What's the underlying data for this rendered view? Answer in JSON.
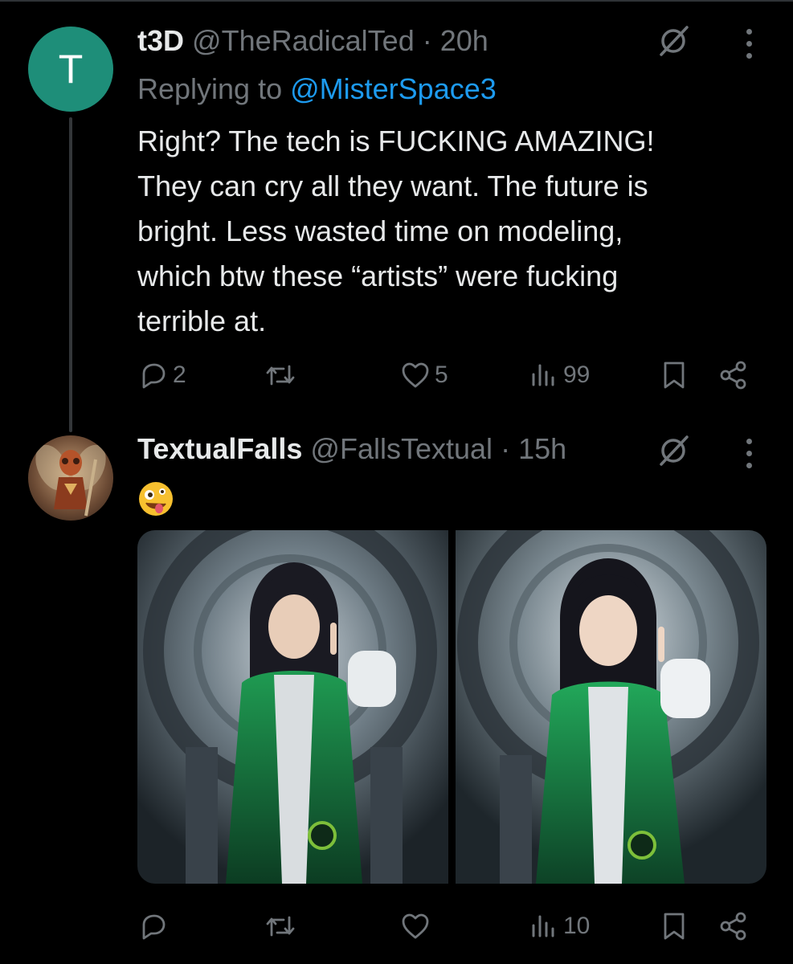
{
  "tweet1": {
    "avatar_letter": "T",
    "avatar_color": "#1e8e79",
    "name": "t3D",
    "handle": "@TheRadicalTed",
    "separator": "·",
    "time": "20h",
    "replying_prefix": "Replying to",
    "replying_to": "@MisterSpace3",
    "body_lines": [
      "Right? The tech is FUCKING AMAZING!",
      "They can cry all they want. The future is",
      "bright. Less wasted time on modeling,",
      "which btw these “artists” were fucking",
      "terrible at."
    ],
    "replies": "2",
    "likes": "5",
    "views": "99"
  },
  "tweet2": {
    "name": "TextualFalls",
    "handle": "@FallsTextual",
    "separator": "·",
    "time": "15h",
    "emoji_icon": "zany-face-emoji",
    "views": "10"
  },
  "icons": [
    "grok-icon",
    "more-icon",
    "reply-icon",
    "retweet-icon",
    "like-icon",
    "views-icon",
    "bookmark-icon",
    "share-icon"
  ],
  "colors": {
    "background": "#000000",
    "text": "#e7e9ea",
    "muted": "#71767b",
    "link": "#1d9bf0"
  }
}
